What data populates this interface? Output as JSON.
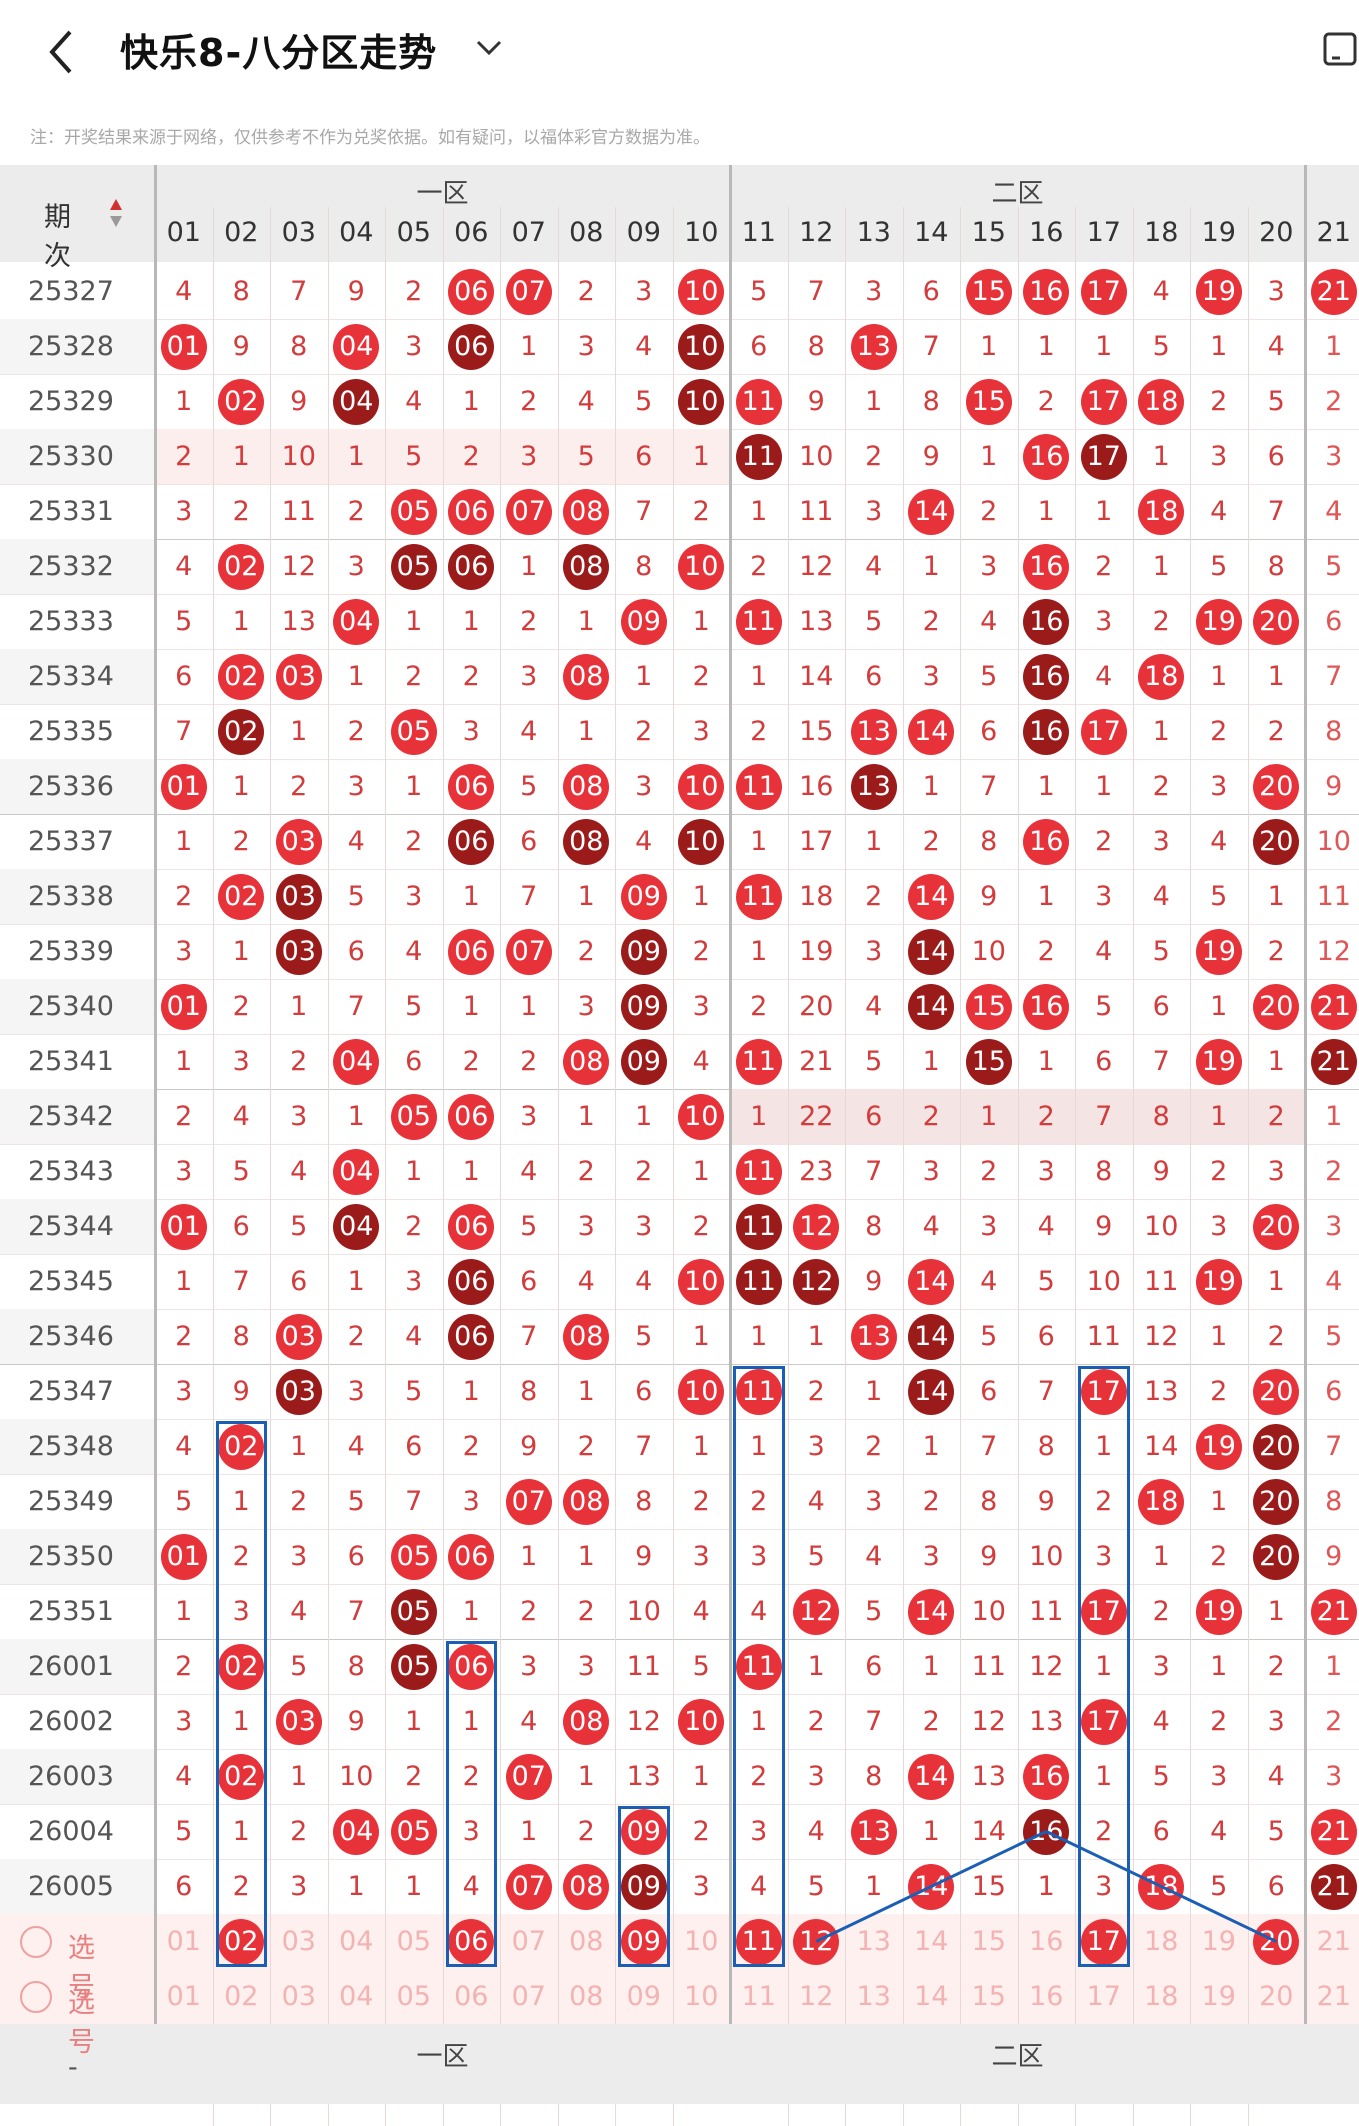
{
  "header": {
    "title": "快乐8-八分区走势"
  },
  "note": "注：开奖结果来源于网络，仅供参考不作为兑奖依据。如有疑问，以福体彩官方数据为准。",
  "table": {
    "period_header": "期次",
    "zones": [
      "一区",
      "二区"
    ],
    "columns": [
      "01",
      "02",
      "03",
      "04",
      "05",
      "06",
      "07",
      "08",
      "09",
      "10",
      "11",
      "12",
      "13",
      "14",
      "15",
      "16",
      "17",
      "18",
      "19",
      "20",
      "21"
    ],
    "rows": [
      {
        "period": "25327",
        "cells": [
          "4",
          "8",
          "7",
          "9",
          "2",
          "06",
          "07",
          "2",
          "3",
          "10",
          "5",
          "7",
          "3",
          "6",
          "15",
          "16",
          "17",
          "4",
          "19",
          "3",
          "21"
        ],
        "hits": [
          6,
          7,
          10,
          15,
          16,
          17,
          19,
          21
        ]
      },
      {
        "period": "25328",
        "cells": [
          "01",
          "9",
          "8",
          "04",
          "3",
          "06",
          "1",
          "3",
          "4",
          "10",
          "6",
          "8",
          "13",
          "7",
          "1",
          "1",
          "1",
          "5",
          "1",
          "4",
          "1"
        ],
        "hits": [
          1,
          4,
          6,
          10,
          13
        ]
      },
      {
        "period": "25329",
        "cells": [
          "1",
          "02",
          "9",
          "04",
          "4",
          "1",
          "2",
          "4",
          "5",
          "10",
          "11",
          "9",
          "1",
          "8",
          "15",
          "2",
          "17",
          "18",
          "2",
          "5",
          "2"
        ],
        "hits": [
          2,
          4,
          10,
          11,
          15,
          17,
          18
        ]
      },
      {
        "period": "25330",
        "cells": [
          "2",
          "1",
          "10",
          "1",
          "5",
          "2",
          "3",
          "5",
          "6",
          "1",
          "11",
          "10",
          "2",
          "9",
          "1",
          "16",
          "17",
          "1",
          "3",
          "6",
          "3"
        ],
        "hits": [
          11,
          16,
          17
        ]
      },
      {
        "period": "25331",
        "cells": [
          "3",
          "2",
          "11",
          "2",
          "05",
          "06",
          "07",
          "08",
          "7",
          "2",
          "1",
          "11",
          "3",
          "14",
          "2",
          "1",
          "1",
          "18",
          "4",
          "7",
          "4"
        ],
        "hits": [
          5,
          6,
          7,
          8,
          14,
          18
        ]
      },
      {
        "period": "25332",
        "cells": [
          "4",
          "02",
          "12",
          "3",
          "05",
          "06",
          "1",
          "08",
          "8",
          "10",
          "2",
          "12",
          "4",
          "1",
          "3",
          "16",
          "2",
          "1",
          "5",
          "8",
          "5"
        ],
        "hits": [
          2,
          5,
          6,
          8,
          10,
          16
        ]
      },
      {
        "period": "25333",
        "cells": [
          "5",
          "1",
          "13",
          "04",
          "1",
          "1",
          "2",
          "1",
          "09",
          "1",
          "11",
          "13",
          "5",
          "2",
          "4",
          "16",
          "3",
          "2",
          "19",
          "20",
          "6"
        ],
        "hits": [
          4,
          9,
          11,
          16,
          19,
          20
        ]
      },
      {
        "period": "25334",
        "cells": [
          "6",
          "02",
          "03",
          "1",
          "2",
          "2",
          "3",
          "08",
          "1",
          "2",
          "1",
          "14",
          "6",
          "3",
          "5",
          "16",
          "4",
          "18",
          "1",
          "1",
          "7"
        ],
        "hits": [
          2,
          3,
          8,
          16,
          18
        ]
      },
      {
        "period": "25335",
        "cells": [
          "7",
          "02",
          "1",
          "2",
          "05",
          "3",
          "4",
          "1",
          "2",
          "3",
          "2",
          "15",
          "13",
          "14",
          "6",
          "16",
          "17",
          "1",
          "2",
          "2",
          "8"
        ],
        "hits": [
          2,
          5,
          13,
          14,
          16,
          17
        ]
      },
      {
        "period": "25336",
        "cells": [
          "01",
          "1",
          "2",
          "3",
          "1",
          "06",
          "5",
          "08",
          "3",
          "10",
          "11",
          "16",
          "13",
          "1",
          "7",
          "1",
          "1",
          "2",
          "3",
          "20",
          "9"
        ],
        "hits": [
          1,
          6,
          8,
          10,
          11,
          13,
          20
        ]
      },
      {
        "period": "25337",
        "cells": [
          "1",
          "2",
          "03",
          "4",
          "2",
          "06",
          "6",
          "08",
          "4",
          "10",
          "1",
          "17",
          "1",
          "2",
          "8",
          "16",
          "2",
          "3",
          "4",
          "20",
          "10"
        ],
        "hits": [
          3,
          6,
          8,
          10,
          16,
          20
        ]
      },
      {
        "period": "25338",
        "cells": [
          "2",
          "02",
          "03",
          "5",
          "3",
          "1",
          "7",
          "1",
          "09",
          "1",
          "11",
          "18",
          "2",
          "14",
          "9",
          "1",
          "3",
          "4",
          "5",
          "1",
          "11"
        ],
        "hits": [
          2,
          3,
          9,
          11,
          14
        ]
      },
      {
        "period": "25339",
        "cells": [
          "3",
          "1",
          "03",
          "6",
          "4",
          "06",
          "07",
          "2",
          "09",
          "2",
          "1",
          "19",
          "3",
          "14",
          "10",
          "2",
          "4",
          "5",
          "19",
          "2",
          "12"
        ],
        "hits": [
          3,
          6,
          7,
          9,
          14,
          19
        ]
      },
      {
        "period": "25340",
        "cells": [
          "01",
          "2",
          "1",
          "7",
          "5",
          "1",
          "1",
          "3",
          "09",
          "3",
          "2",
          "20",
          "4",
          "14",
          "15",
          "16",
          "5",
          "6",
          "1",
          "20",
          "21"
        ],
        "hits": [
          1,
          9,
          14,
          15,
          16,
          20,
          21
        ]
      },
      {
        "period": "25341",
        "cells": [
          "1",
          "3",
          "2",
          "04",
          "6",
          "2",
          "2",
          "08",
          "09",
          "4",
          "11",
          "21",
          "5",
          "1",
          "15",
          "1",
          "6",
          "7",
          "19",
          "1",
          "21"
        ],
        "hits": [
          4,
          8,
          9,
          11,
          15,
          19,
          21
        ]
      },
      {
        "period": "25342",
        "cells": [
          "2",
          "4",
          "3",
          "1",
          "05",
          "06",
          "3",
          "1",
          "1",
          "10",
          "1",
          "22",
          "6",
          "2",
          "1",
          "2",
          "7",
          "8",
          "1",
          "2",
          "1"
        ],
        "hits": [
          5,
          6,
          10
        ]
      },
      {
        "period": "25343",
        "cells": [
          "3",
          "5",
          "4",
          "04",
          "1",
          "1",
          "4",
          "2",
          "2",
          "1",
          "11",
          "23",
          "7",
          "3",
          "2",
          "3",
          "8",
          "9",
          "2",
          "3",
          "2"
        ],
        "hits": [
          4,
          11
        ]
      },
      {
        "period": "25344",
        "cells": [
          "01",
          "6",
          "5",
          "04",
          "2",
          "06",
          "5",
          "3",
          "3",
          "2",
          "11",
          "12",
          "8",
          "4",
          "3",
          "4",
          "9",
          "10",
          "3",
          "20",
          "3"
        ],
        "hits": [
          1,
          4,
          6,
          11,
          12,
          20
        ]
      },
      {
        "period": "25345",
        "cells": [
          "1",
          "7",
          "6",
          "1",
          "3",
          "06",
          "6",
          "4",
          "4",
          "10",
          "11",
          "12",
          "9",
          "14",
          "4",
          "5",
          "10",
          "11",
          "19",
          "1",
          "4"
        ],
        "hits": [
          6,
          10,
          11,
          12,
          14,
          19
        ]
      },
      {
        "period": "25346",
        "cells": [
          "2",
          "8",
          "03",
          "2",
          "4",
          "06",
          "7",
          "08",
          "5",
          "1",
          "1",
          "1",
          "13",
          "14",
          "5",
          "6",
          "11",
          "12",
          "1",
          "2",
          "5"
        ],
        "hits": [
          3,
          6,
          8,
          13,
          14
        ]
      },
      {
        "period": "25347",
        "cells": [
          "3",
          "9",
          "03",
          "3",
          "5",
          "1",
          "8",
          "1",
          "6",
          "10",
          "11",
          "2",
          "1",
          "14",
          "6",
          "7",
          "17",
          "13",
          "2",
          "20",
          "6"
        ],
        "hits": [
          3,
          10,
          11,
          14,
          17,
          20
        ]
      },
      {
        "period": "25348",
        "cells": [
          "4",
          "02",
          "1",
          "4",
          "6",
          "2",
          "9",
          "2",
          "7",
          "1",
          "1",
          "3",
          "2",
          "1",
          "7",
          "8",
          "1",
          "14",
          "19",
          "20",
          "7"
        ],
        "hits": [
          2,
          19,
          20
        ]
      },
      {
        "period": "25349",
        "cells": [
          "5",
          "1",
          "2",
          "5",
          "7",
          "3",
          "07",
          "08",
          "8",
          "2",
          "2",
          "4",
          "3",
          "2",
          "8",
          "9",
          "2",
          "18",
          "1",
          "20",
          "8"
        ],
        "hits": [
          7,
          8,
          18,
          20
        ]
      },
      {
        "period": "25350",
        "cells": [
          "01",
          "2",
          "3",
          "6",
          "05",
          "06",
          "1",
          "1",
          "9",
          "3",
          "3",
          "5",
          "4",
          "3",
          "9",
          "10",
          "3",
          "1",
          "2",
          "20",
          "9"
        ],
        "hits": [
          1,
          5,
          6,
          20
        ]
      },
      {
        "period": "25351",
        "cells": [
          "1",
          "3",
          "4",
          "7",
          "05",
          "1",
          "2",
          "2",
          "10",
          "4",
          "4",
          "12",
          "5",
          "14",
          "10",
          "11",
          "17",
          "2",
          "19",
          "1",
          "21"
        ],
        "hits": [
          5,
          12,
          14,
          17,
          19,
          21
        ]
      },
      {
        "period": "26001",
        "cells": [
          "2",
          "02",
          "5",
          "8",
          "05",
          "06",
          "3",
          "3",
          "11",
          "5",
          "11",
          "1",
          "6",
          "1",
          "11",
          "12",
          "1",
          "3",
          "1",
          "2",
          "1"
        ],
        "hits": [
          2,
          5,
          6,
          11
        ]
      },
      {
        "period": "26002",
        "cells": [
          "3",
          "1",
          "03",
          "9",
          "1",
          "1",
          "4",
          "08",
          "12",
          "10",
          "1",
          "2",
          "7",
          "2",
          "12",
          "13",
          "17",
          "4",
          "2",
          "3",
          "2"
        ],
        "hits": [
          3,
          8,
          10,
          17
        ]
      },
      {
        "period": "26003",
        "cells": [
          "4",
          "02",
          "1",
          "10",
          "2",
          "2",
          "07",
          "1",
          "13",
          "1",
          "2",
          "3",
          "8",
          "14",
          "13",
          "16",
          "1",
          "5",
          "3",
          "4",
          "3"
        ],
        "hits": [
          2,
          7,
          14,
          16
        ]
      },
      {
        "period": "26004",
        "cells": [
          "5",
          "1",
          "2",
          "04",
          "05",
          "3",
          "1",
          "2",
          "09",
          "2",
          "3",
          "4",
          "13",
          "1",
          "14",
          "16",
          "2",
          "6",
          "4",
          "5",
          "21"
        ],
        "hits": [
          4,
          5,
          9,
          13,
          16,
          21
        ]
      },
      {
        "period": "26005",
        "cells": [
          "6",
          "2",
          "3",
          "1",
          "1",
          "4",
          "07",
          "08",
          "09",
          "3",
          "4",
          "5",
          "1",
          "14",
          "15",
          "1",
          "3",
          "18",
          "5",
          "6",
          "21"
        ],
        "hits": [
          7,
          8,
          9,
          14,
          18,
          21
        ]
      }
    ],
    "select_rows": [
      {
        "label": "选号",
        "selected": [
          2,
          6,
          9,
          11,
          12,
          17,
          20
        ]
      },
      {
        "label": "选号",
        "selected": []
      }
    ]
  }
}
